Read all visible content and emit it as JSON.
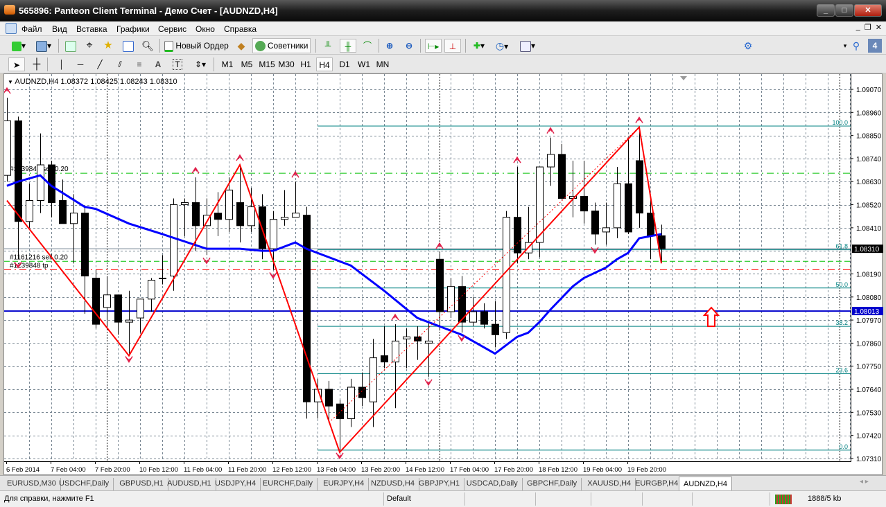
{
  "window": {
    "title": "565896: Panteon Client Terminal - Демо Счет - [AUDNZD,H4]"
  },
  "menu": [
    "Файл",
    "Вид",
    "Вставка",
    "Графики",
    "Сервис",
    "Окно",
    "Справка"
  ],
  "toolbar": {
    "new_order": "Новый Ордер",
    "experts": "Советники",
    "search_placeholder": "",
    "badge": "4"
  },
  "timeframes": [
    "M1",
    "M5",
    "M15",
    "M30",
    "H1",
    "H4",
    "D1",
    "W1",
    "MN"
  ],
  "active_timeframe": "H4",
  "chart_info": "AUDNZD,H4  1.08372 1.08425 1.08243 1.08310",
  "colors": {
    "bull": "#ffffff",
    "bear": "#000000",
    "ma": "#0000ff",
    "zigzag": "#ff0000",
    "fib": "#008080",
    "grid": "#7a8894"
  },
  "chart_data": {
    "type": "candlestick",
    "symbol": "AUDNZD",
    "timeframe": "H4",
    "ylim": [
      1.0731,
      1.0907
    ],
    "yticks": [
      "1.09070",
      "1.08960",
      "1.08850",
      "1.08740",
      "1.08630",
      "1.08520",
      "1.08410",
      "1.08310",
      "1.08190",
      "1.08080",
      "1.08013",
      "1.07970",
      "1.07860",
      "1.07750",
      "1.07640",
      "1.07530",
      "1.07420",
      "1.07310"
    ],
    "ytick_values": [
      1.0907,
      1.0896,
      1.0885,
      1.0874,
      1.0863,
      1.0852,
      1.0841,
      1.0831,
      1.0819,
      1.0808,
      1.08013,
      1.0797,
      1.0786,
      1.0775,
      1.0764,
      1.0753,
      1.0742,
      1.0731
    ],
    "xticks": [
      "6 Feb 2014",
      "7 Feb 04:00",
      "7 Feb 20:00",
      "10 Feb 12:00",
      "11 Feb 04:00",
      "11 Feb 20:00",
      "12 Feb 12:00",
      "13 Feb 04:00",
      "13 Feb 20:00",
      "14 Feb 12:00",
      "17 Feb 04:00",
      "17 Feb 20:00",
      "18 Feb 12:00",
      "19 Feb 04:00",
      "19 Feb 20:00"
    ],
    "ohlc": [
      [
        1.0866,
        1.0903,
        1.0863,
        1.0892
      ],
      [
        1.0892,
        1.0894,
        1.0826,
        1.0844
      ],
      [
        1.0844,
        1.0862,
        1.0841,
        1.0854
      ],
      [
        1.0854,
        1.0886,
        1.0848,
        1.0871
      ],
      [
        1.0871,
        1.0873,
        1.0846,
        1.0853
      ],
      [
        1.0854,
        1.0864,
        1.0843,
        1.0843
      ],
      [
        1.0843,
        1.0857,
        1.0824,
        1.0848
      ],
      [
        1.0848,
        1.0851,
        1.08,
        1.0818
      ],
      [
        1.0817,
        1.0821,
        1.0793,
        1.0795
      ],
      [
        1.0803,
        1.0818,
        1.0793,
        1.0809
      ],
      [
        1.0809,
        1.0809,
        1.079,
        1.0796
      ],
      [
        1.0796,
        1.0811,
        1.0781,
        1.0797
      ],
      [
        1.0798,
        1.0807,
        1.0791,
        1.0807
      ],
      [
        1.0807,
        1.0817,
        1.0801,
        1.0816
      ],
      [
        1.0817,
        1.0828,
        1.0814,
        1.0817
      ],
      [
        1.0818,
        1.0855,
        1.0811,
        1.0852
      ],
      [
        1.0852,
        1.0855,
        1.0837,
        1.0853
      ],
      [
        1.0853,
        1.0865,
        1.083,
        1.0842
      ],
      [
        1.0842,
        1.0855,
        1.0828,
        1.0847
      ],
      [
        1.0848,
        1.0858,
        1.0837,
        1.0845
      ],
      [
        1.0845,
        1.0865,
        1.0839,
        1.0859
      ],
      [
        1.0853,
        1.0871,
        1.0834,
        1.0842
      ],
      [
        1.0842,
        1.086,
        1.0839,
        1.0851
      ],
      [
        1.0851,
        1.0857,
        1.0826,
        1.0831
      ],
      [
        1.0831,
        1.0849,
        1.0821,
        1.0845
      ],
      [
        1.0845,
        1.0859,
        1.0842,
        1.0846
      ],
      [
        1.0846,
        1.0863,
        1.0846,
        1.0848
      ],
      [
        1.0847,
        1.0851,
        1.075,
        1.0758
      ],
      [
        1.0758,
        1.0769,
        1.075,
        1.0764
      ],
      [
        1.0764,
        1.0768,
        1.0748,
        1.0756
      ],
      [
        1.0757,
        1.0759,
        1.0735,
        1.075
      ],
      [
        1.075,
        1.0769,
        1.0746,
        1.0765
      ],
      [
        1.0765,
        1.0772,
        1.0756,
        1.076
      ],
      [
        1.0758,
        1.0788,
        1.0746,
        1.0779
      ],
      [
        1.078,
        1.0794,
        1.0774,
        1.0777
      ],
      [
        1.0777,
        1.0795,
        1.0755,
        1.0787
      ],
      [
        1.0788,
        1.0793,
        1.0774,
        1.0789
      ],
      [
        1.0789,
        1.0794,
        1.0778,
        1.0787
      ],
      [
        1.0786,
        1.0796,
        1.077,
        1.0787
      ],
      [
        1.0826,
        1.0829,
        1.0792,
        1.0801
      ],
      [
        1.0801,
        1.0817,
        1.0798,
        1.0813
      ],
      [
        1.0813,
        1.0818,
        1.0791,
        1.0796
      ],
      [
        1.0796,
        1.0808,
        1.0794,
        1.0801
      ],
      [
        1.0801,
        1.0805,
        1.0793,
        1.0795
      ],
      [
        1.0795,
        1.0806,
        1.0784,
        1.079
      ],
      [
        1.0791,
        1.0849,
        1.0788,
        1.0846
      ],
      [
        1.0846,
        1.087,
        1.0824,
        1.0829
      ],
      [
        1.0829,
        1.0851,
        1.0826,
        1.0834
      ],
      [
        1.0834,
        1.087,
        1.0827,
        1.087
      ],
      [
        1.087,
        1.0884,
        1.0861,
        1.0876
      ],
      [
        1.0876,
        1.0881,
        1.0855,
        1.0855
      ],
      [
        1.0855,
        1.0873,
        1.0846,
        1.0856
      ],
      [
        1.0856,
        1.0873,
        1.0843,
        1.0849
      ],
      [
        1.0849,
        1.0853,
        1.0833,
        1.0838
      ],
      [
        1.0839,
        1.0853,
        1.0833,
        1.0841
      ],
      [
        1.0841,
        1.087,
        1.0836,
        1.0862
      ],
      [
        1.0862,
        1.0884,
        1.0838,
        1.0839
      ],
      [
        1.0873,
        1.0889,
        1.0841,
        1.0848
      ],
      [
        1.0848,
        1.0855,
        1.0826,
        1.0837
      ],
      [
        1.08372,
        1.08425,
        1.08243,
        1.0831
      ]
    ],
    "moving_average": [
      [
        0,
        1.0861
      ],
      [
        1,
        1.0863
      ],
      [
        3,
        1.0866
      ],
      [
        4,
        1.0861
      ],
      [
        7,
        1.0851
      ],
      [
        8,
        1.085
      ],
      [
        11,
        1.0843
      ],
      [
        14,
        1.0838
      ],
      [
        18,
        1.0831
      ],
      [
        21,
        1.0831
      ],
      [
        23,
        1.083
      ],
      [
        24,
        1.083
      ],
      [
        26,
        1.0834
      ],
      [
        27,
        1.0831
      ],
      [
        29,
        1.0827
      ],
      [
        31,
        1.0823
      ],
      [
        34,
        1.0811
      ],
      [
        37,
        1.0798
      ],
      [
        39,
        1.0794
      ],
      [
        41,
        1.079
      ],
      [
        44,
        1.0781
      ],
      [
        46,
        1.0789
      ],
      [
        47,
        1.0791
      ],
      [
        48,
        1.0796
      ],
      [
        49,
        1.0802
      ],
      [
        51,
        1.0813
      ],
      [
        52,
        1.0817
      ],
      [
        54,
        1.0822
      ],
      [
        55,
        1.0826
      ],
      [
        56,
        1.0829
      ],
      [
        57,
        1.0836
      ],
      [
        59,
        1.0838
      ]
    ],
    "zigzag": [
      [
        0,
        1.0854
      ],
      [
        11,
        1.078
      ],
      [
        21,
        1.0871
      ],
      [
        30,
        1.0734
      ],
      [
        57,
        1.0889
      ],
      [
        59,
        1.0824
      ]
    ],
    "fractals_up": [
      0,
      17,
      21,
      26,
      35,
      39,
      46,
      49,
      57
    ],
    "fractals_down": [
      1,
      11,
      18,
      24,
      30,
      38,
      41,
      53
    ],
    "fibonacci": {
      "start_index": 28,
      "levels": [
        {
          "label": "100.0",
          "price": 1.08895
        },
        {
          "label": "61.8",
          "price": 1.08305
        },
        {
          "label": "50.0",
          "price": 1.08123
        },
        {
          "label": "38.2",
          "price": 1.0794
        },
        {
          "label": "23.6",
          "price": 1.07715
        },
        {
          "label": "0.0",
          "price": 1.0735
        }
      ]
    },
    "orders": [
      {
        "label": "#1239848 sell 0.20",
        "price": 1.0867,
        "color": "#00c000",
        "style": "dashdot"
      },
      {
        "label": "#1161216 sell 0.20",
        "price": 1.0825,
        "color": "#00c000",
        "style": "dash"
      },
      {
        "label": "#1239848 tp",
        "price": 1.0821,
        "color": "#ff0000",
        "style": "dashdot"
      }
    ],
    "hline": {
      "price": 1.08013,
      "label": "1.08013"
    },
    "bid": {
      "price": 1.0831,
      "label": "1.08310"
    },
    "period_separators": [
      9,
      39
    ],
    "arrow_up_marker": {
      "index": 63.5,
      "price": 1.0798
    }
  },
  "tabs": [
    "EURUSD,M30",
    "USDCHF,Daily",
    "GBPUSD,H1",
    "AUDUSD,H1",
    "USDJPY,H4",
    "EURCHF,Daily",
    "EURJPY,H4",
    "NZDUSD,H4",
    "GBPJPY,H1",
    "USDCAD,Daily",
    "GBPCHF,Daily",
    "XAUUSD,H4",
    "EURGBP,H4",
    "AUDNZD,H4"
  ],
  "active_tab": "AUDNZD,H4",
  "status": {
    "help": "Для справки, нажмите F1",
    "profile": "Default",
    "traffic": "1888/5 kb"
  }
}
